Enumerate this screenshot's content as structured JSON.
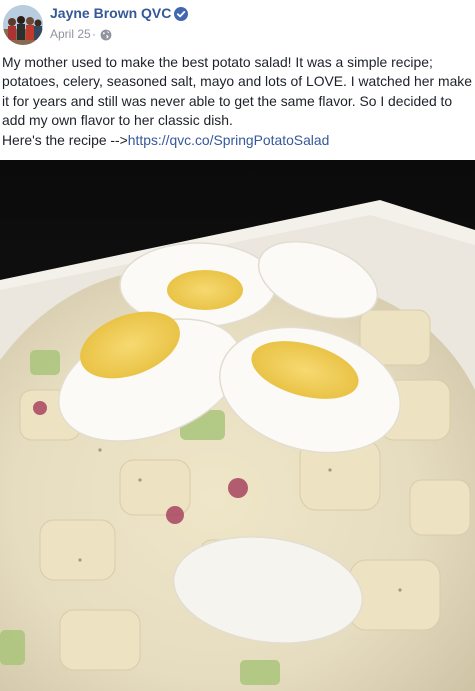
{
  "post": {
    "author": "Jayne Brown QVC",
    "date": "April 25",
    "separator": "·",
    "privacy_icon": "globe-icon",
    "verified_icon": "verified-badge-icon",
    "text_lines": [
      "My mother used to make the best potato salad! It was a simple recipe;",
      "potatoes, celery, seasoned salt, mayo and lots of LOVE. I watched her make",
      "it for years and still was never able to get the same flavor. So I decided to",
      "add my own flavor to her classic dish."
    ],
    "recipe_prefix": "Here's the recipe -->",
    "recipe_link": "https://qvc.co/SpringPotatoSalad",
    "photo_subject": "potato salad with sliced hard-boiled eggs"
  },
  "colors": {
    "link": "#365899",
    "verified": "#4267b2",
    "meta": "#90949c",
    "text": "#1d2129"
  }
}
